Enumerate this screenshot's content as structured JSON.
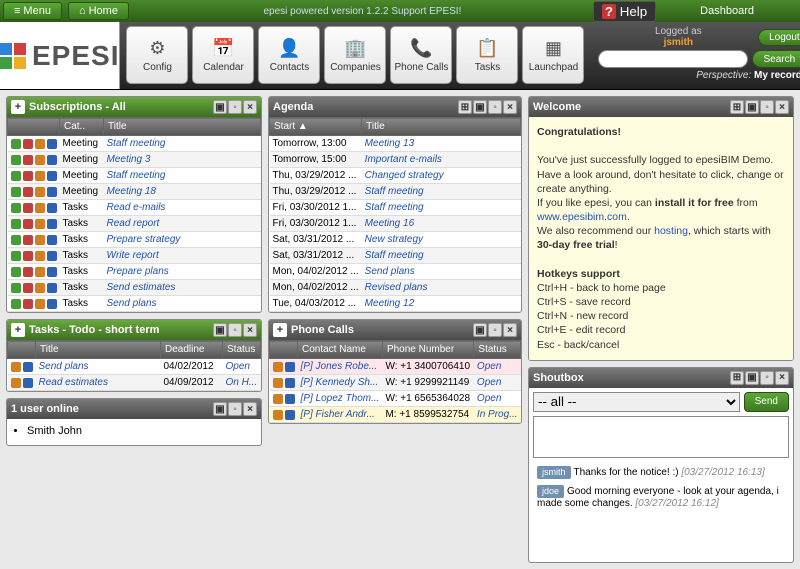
{
  "top": {
    "menu": "Menu",
    "home": "Home",
    "powered": "epesi powered  version 1.2.2   Support EPESI!",
    "help": "Help",
    "dashboard": "Dashboard"
  },
  "user": {
    "logged_as": "Logged as",
    "name": "jsmith",
    "logout": "Logout",
    "search": "Search",
    "perspective_label": "Perspective:",
    "perspective": "My records"
  },
  "toolbar": [
    {
      "label": "Config",
      "icon": "⚙"
    },
    {
      "label": "Calendar",
      "icon": "📅"
    },
    {
      "label": "Contacts",
      "icon": "👤"
    },
    {
      "label": "Companies",
      "icon": "🏢"
    },
    {
      "label": "Phone Calls",
      "icon": "📞"
    },
    {
      "label": "Tasks",
      "icon": "📋"
    },
    {
      "label": "Launchpad",
      "icon": "▦"
    }
  ],
  "subs": {
    "title": "Subscriptions - All",
    "cols": [
      "",
      "Cat..",
      "Title"
    ],
    "rows": [
      {
        "cat": "Meeting",
        "title": "Staff meeting"
      },
      {
        "cat": "Meeting",
        "title": "Meeting 3"
      },
      {
        "cat": "Meeting",
        "title": "Staff meeting"
      },
      {
        "cat": "Meeting",
        "title": "Meeting 18"
      },
      {
        "cat": "Tasks",
        "title": "Read e-mails"
      },
      {
        "cat": "Tasks",
        "title": "Read report"
      },
      {
        "cat": "Tasks",
        "title": "Prepare strategy"
      },
      {
        "cat": "Tasks",
        "title": "Write report"
      },
      {
        "cat": "Tasks",
        "title": "Prepare plans"
      },
      {
        "cat": "Tasks",
        "title": "Send estimates"
      },
      {
        "cat": "Tasks",
        "title": "Send plans"
      }
    ]
  },
  "tasks": {
    "title": "Tasks - Todo - short term",
    "cols": [
      "",
      "Title",
      "Deadline",
      "Status"
    ],
    "rows": [
      {
        "title": "Send plans",
        "deadline": "04/02/2012",
        "status": "Open"
      },
      {
        "title": "Read estimates",
        "deadline": "04/09/2012",
        "status": "On H..."
      }
    ]
  },
  "online": {
    "title": "1 user online",
    "users": [
      "Smith John"
    ]
  },
  "agenda": {
    "title": "Agenda",
    "cols": [
      "Start ▲",
      "Title"
    ],
    "rows": [
      {
        "start": "Tomorrow, 13:00",
        "title": "Meeting 13"
      },
      {
        "start": "Tomorrow, 15:00",
        "title": "Important e-mails"
      },
      {
        "start": "Thu, 03/29/2012 ...",
        "title": "Changed strategy"
      },
      {
        "start": "Thu, 03/29/2012 ...",
        "title": "Staff meeting"
      },
      {
        "start": "Fri, 03/30/2012 1...",
        "title": "Staff meeting"
      },
      {
        "start": "Fri, 03/30/2012 1...",
        "title": "Meeting 16"
      },
      {
        "start": "Sat, 03/31/2012 ...",
        "title": "New strategy"
      },
      {
        "start": "Sat, 03/31/2012 ...",
        "title": "Staff meeting"
      },
      {
        "start": "Mon, 04/02/2012 ...",
        "title": "Send plans"
      },
      {
        "start": "Mon, 04/02/2012 ...",
        "title": "Revised plans"
      },
      {
        "start": "Tue, 04/03/2012 ...",
        "title": "Meeting 12"
      }
    ]
  },
  "phone": {
    "title": "Phone Calls",
    "cols": [
      "",
      "Contact Name",
      "Phone Number",
      "Status"
    ],
    "rows": [
      {
        "name": "[P] Jones Robe...",
        "num": "W: +1 3400706410",
        "status": "Open",
        "cls": "pc-open"
      },
      {
        "name": "[P] Kennedy Sh...",
        "num": "W: +1 9299921149",
        "status": "Open",
        "cls": ""
      },
      {
        "name": "[P] Lopez Thom...",
        "num": "W: +1 6565364028",
        "status": "Open",
        "cls": ""
      },
      {
        "name": "[P] Fisher Andr...",
        "num": "M: +1 8599532754",
        "status": "In Prog...",
        "cls": "pc-prog"
      }
    ]
  },
  "welcome": {
    "title": "Welcome",
    "heading": "Congratulations!",
    "p1a": "You've just successfully logged to epesiBIM Demo. Have a look around, don't hesitate to click, change or create anything.",
    "p1b": "If you like epesi, you can ",
    "install": "install it for free",
    "from": " from ",
    "url": "www.epesibim.com",
    "p2a": "We also recommend our ",
    "hosting": "hosting",
    "p2b": ", which starts with ",
    "trial": "30-day free trial",
    "hotkeys_h": "Hotkeys support",
    "hk": [
      "Ctrl+H - back to home page",
      "Ctrl+S - save record",
      "Ctrl+N - new record",
      "Ctrl+E - edit record",
      "Esc - back/cancel"
    ]
  },
  "shout": {
    "title": "Shoutbox",
    "filter": "-- all --",
    "send": "Send",
    "msgs": [
      {
        "user": "jsmith",
        "text": "Thanks for the notice! :)",
        "time": "[03/27/2012 16:13]"
      },
      {
        "user": "jdoe",
        "text": "Good morning everyone - look at your agenda, i made some changes.",
        "time": "[03/27/2012 16:12]"
      }
    ]
  }
}
